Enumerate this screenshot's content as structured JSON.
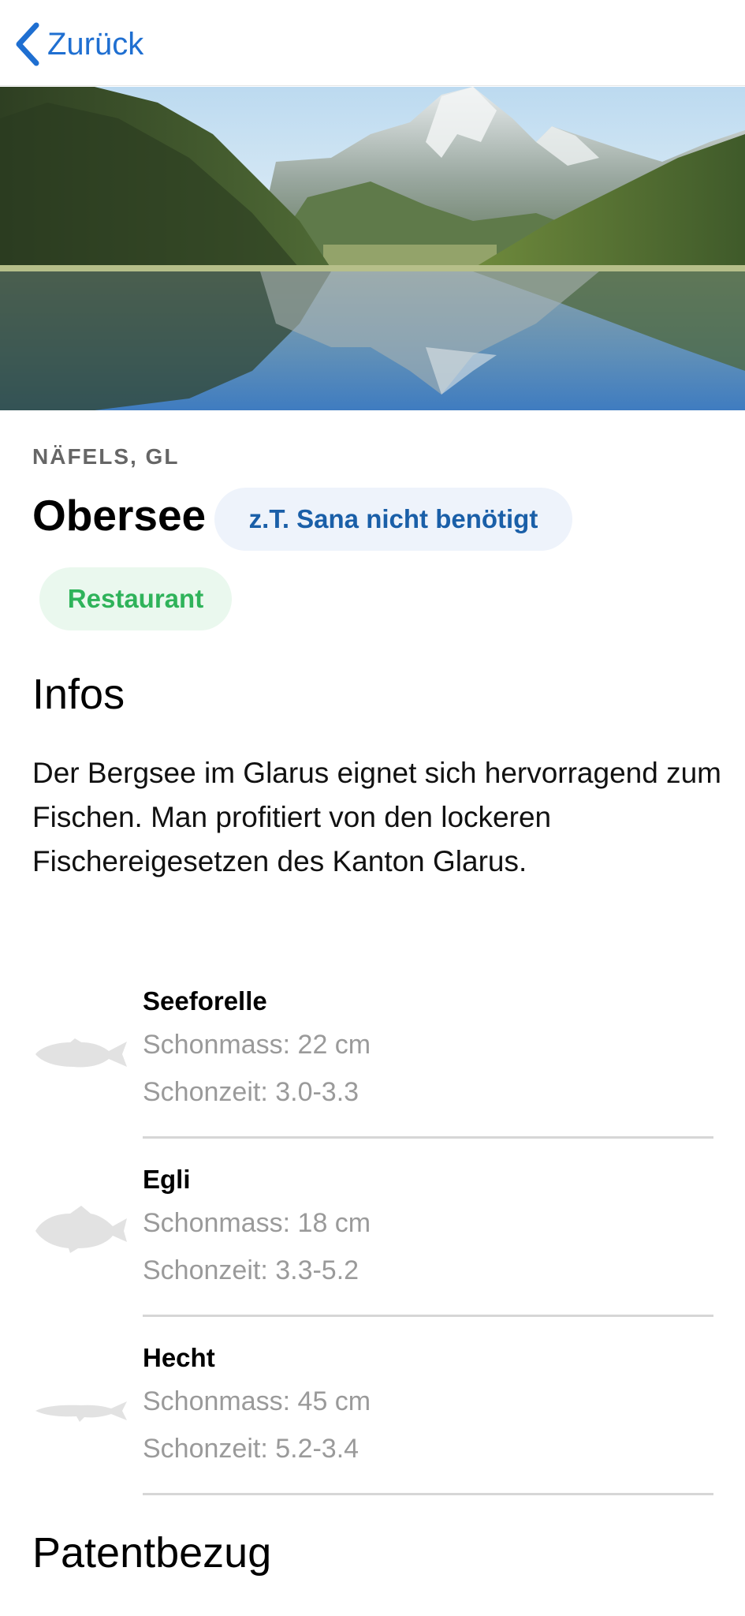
{
  "nav": {
    "back_label": "Zurück"
  },
  "location": "NÄFELS, GL",
  "title": "Obersee",
  "tags": {
    "sana": "z.T. Sana nicht benötigt",
    "restaurant": "Restaurant"
  },
  "infos": {
    "heading": "Infos",
    "description": "Der Bergsee im Glarus eignet sich hervorragend zum Fischen. Man profitiert von den lockeren Fischereigesetzen des Kanton Glarus."
  },
  "fish": [
    {
      "name": "Seeforelle",
      "size": "Schonmass: 22 cm",
      "season": "Schonzeit: 3.0-3.3",
      "icon": "trout-icon"
    },
    {
      "name": "Egli",
      "size": "Schonmass: 18 cm",
      "season": "Schonzeit: 3.3-5.2",
      "icon": "perch-icon"
    },
    {
      "name": "Hecht",
      "size": "Schonmass: 45 cm",
      "season": "Schonzeit: 5.2-3.4",
      "icon": "pike-icon"
    }
  ],
  "patent": {
    "heading": "Patentbezug"
  },
  "colors": {
    "accent_blue": "#1f6fd1",
    "tag_blue_text": "#1a5fa8",
    "tag_green_text": "#2fb35a"
  }
}
